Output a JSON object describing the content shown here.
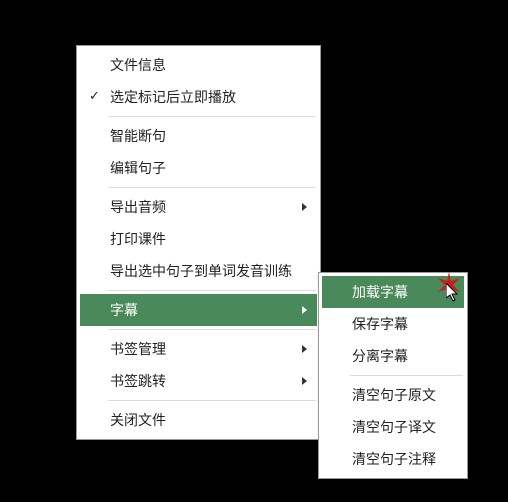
{
  "menu": {
    "items": [
      {
        "label": "文件信息",
        "checked": false,
        "submenu": false
      },
      {
        "label": "选定标记后立即播放",
        "checked": true,
        "submenu": false
      },
      {
        "label": "智能断句",
        "checked": false,
        "submenu": false
      },
      {
        "label": "编辑句子",
        "checked": false,
        "submenu": false
      },
      {
        "label": "导出音频",
        "checked": false,
        "submenu": true
      },
      {
        "label": "打印课件",
        "checked": false,
        "submenu": false
      },
      {
        "label": "导出选中句子到单词发音训练",
        "checked": false,
        "submenu": false
      },
      {
        "label": "字幕",
        "checked": false,
        "submenu": true,
        "highlighted": true
      },
      {
        "label": "书签管理",
        "checked": false,
        "submenu": true
      },
      {
        "label": "书签跳转",
        "checked": false,
        "submenu": true
      },
      {
        "label": "关闭文件",
        "checked": false,
        "submenu": false
      }
    ]
  },
  "submenu": {
    "items": [
      {
        "label": "加载字幕",
        "highlighted": true
      },
      {
        "label": "保存字幕"
      },
      {
        "label": "分离字幕"
      },
      {
        "label": "清空句子原文"
      },
      {
        "label": "清空句子译文"
      },
      {
        "label": "清空句子注释"
      }
    ]
  },
  "colors": {
    "highlight": "#4a8a5a"
  }
}
